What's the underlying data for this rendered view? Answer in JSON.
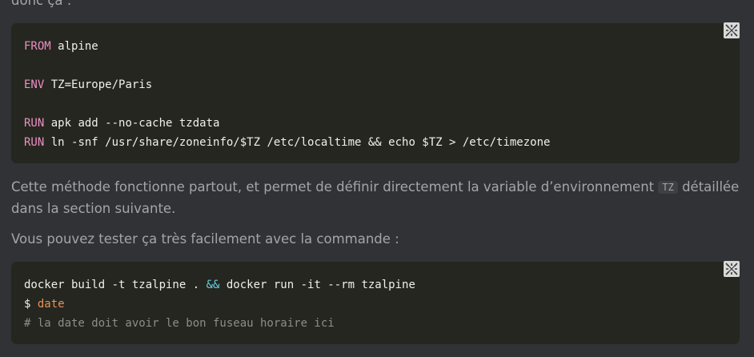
{
  "intro_text": "donc ça :",
  "code_block_1": {
    "lines": [
      {
        "kw": "FROM",
        "rest": " alpine"
      },
      {
        "kw": "",
        "rest": ""
      },
      {
        "kw": "ENV",
        "rest": " TZ=Europe/Paris"
      },
      {
        "kw": "",
        "rest": ""
      },
      {
        "kw": "RUN",
        "rest": " apk add --no-cache tzdata"
      },
      {
        "kw": "RUN",
        "rest": " ln -snf /usr/share/zoneinfo/$TZ /etc/localtime && echo $TZ > /etc/timezone"
      }
    ]
  },
  "paragraph_1": {
    "before": "Cette méthode fonctionne partout, et permet de définir directement la variable d’environnement ",
    "code": "TZ",
    "after": " détaillée dans la section suivante."
  },
  "paragraph_2": "Vous pouvez tester ça très facilement avec la commande :",
  "code_block_2": {
    "line1_a": "docker build -t tzalpine . ",
    "line1_op": "&&",
    "line1_b": " docker run -it --rm tzalpine",
    "line2_prompt": "$ ",
    "line2_cmd": "date",
    "line3_comment": "# la date doit avoir le bon fuseau horaire ici"
  },
  "icons": {
    "copy": "copy-code-icon"
  }
}
